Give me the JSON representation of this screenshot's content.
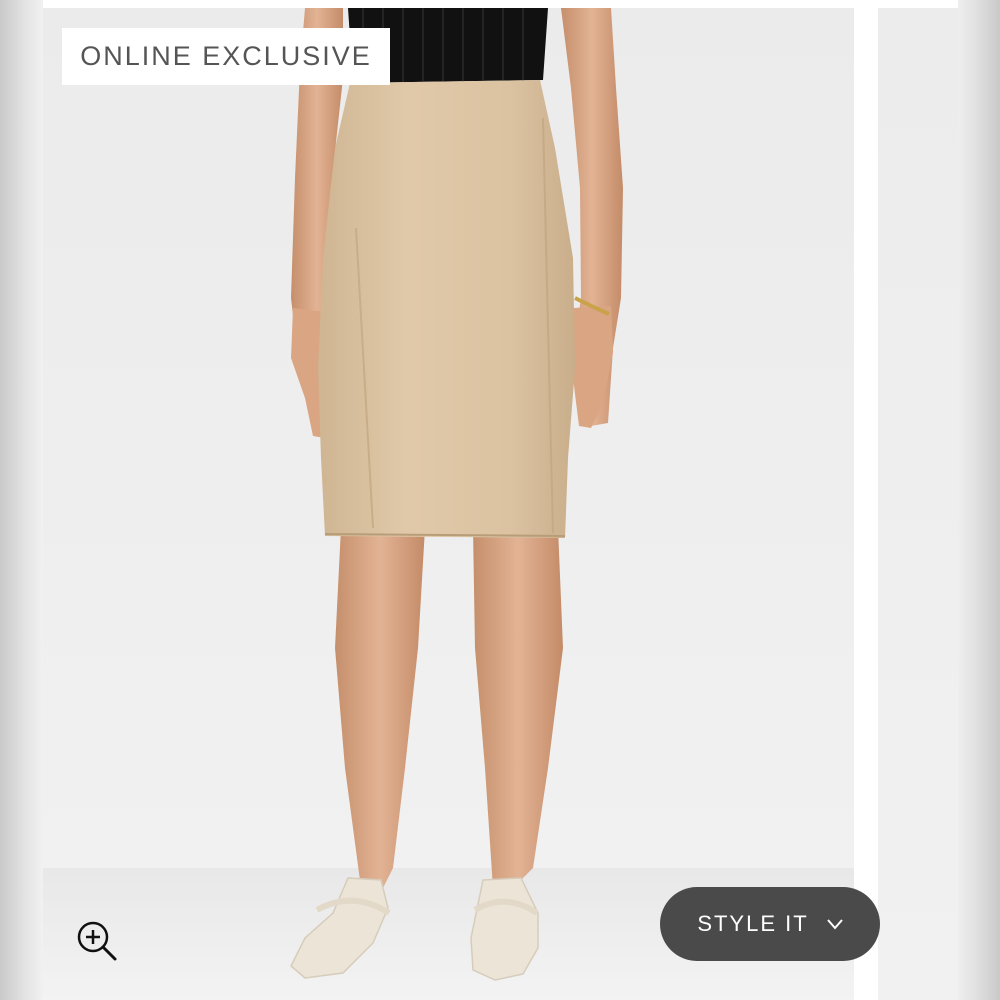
{
  "badge": {
    "label": "ONLINE EXCLUSIVE"
  },
  "actions": {
    "style_it_label": "STYLE IT",
    "style_it_icon": "chevron-down-icon",
    "zoom_icon": "zoom-in-icon"
  },
  "product_image": {
    "subject": "pencil skirt",
    "skirt_color": "#dcc4a4",
    "top_color": "#111111",
    "shoe_color": "#ece4d6"
  },
  "colors": {
    "badge_bg": "#ffffff",
    "badge_text": "#555555",
    "button_bg": "#4a4a4a",
    "button_text": "#ffffff"
  }
}
